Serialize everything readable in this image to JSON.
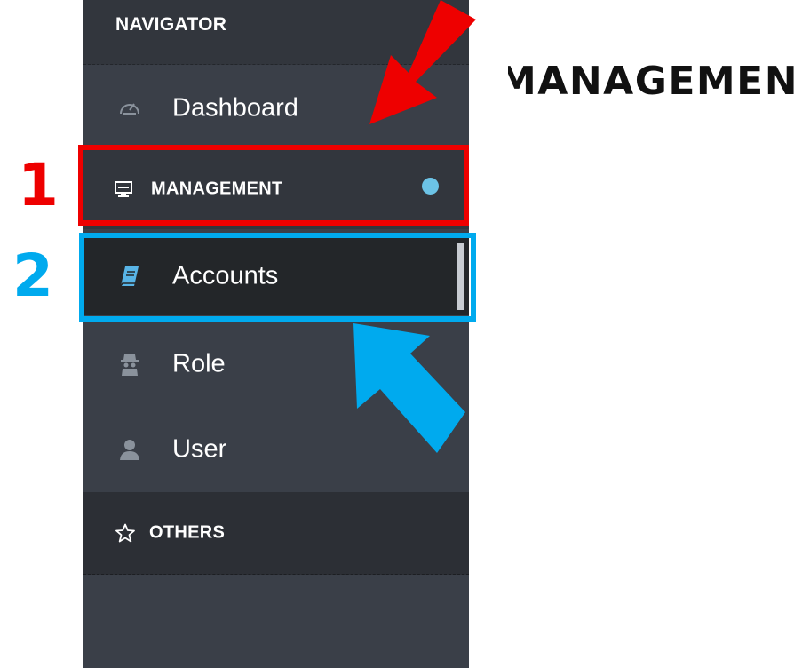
{
  "sidebar": {
    "header": "NAVIGATOR",
    "items": [
      {
        "label": "Dashboard",
        "icon": "speedometer-icon"
      },
      {
        "label": "MANAGEMENT",
        "icon": "monitor-icon",
        "indicator_color": "#6cc3e6"
      },
      {
        "label": "Accounts",
        "icon": "book-icon",
        "active": true
      },
      {
        "label": "Role",
        "icon": "spy-icon"
      },
      {
        "label": "User",
        "icon": "user-icon"
      },
      {
        "label": "OTHERS",
        "icon": "star-icon"
      }
    ]
  },
  "heading": "MANAGEMENT",
  "annotations": {
    "label_1": "1",
    "label_2": "2",
    "color_1": "#ee0000",
    "color_2": "#00aaee"
  }
}
